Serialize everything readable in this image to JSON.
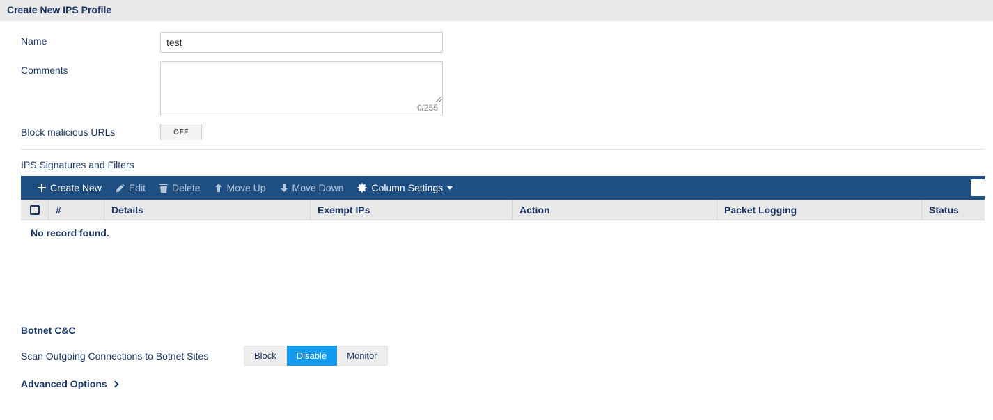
{
  "header": {
    "title": "Create New IPS Profile"
  },
  "form": {
    "name_label": "Name",
    "name_value": "test",
    "comments_label": "Comments",
    "comments_value": "",
    "comments_counter": "0/255",
    "block_urls_label": "Block malicious URLs",
    "block_urls_toggle": "OFF"
  },
  "signatures": {
    "section_label": "IPS Signatures and Filters",
    "toolbar": {
      "create_new": "Create New",
      "edit": "Edit",
      "delete": "Delete",
      "move_up": "Move Up",
      "move_down": "Move Down",
      "column_settings": "Column Settings"
    },
    "columns": {
      "num": "#",
      "details": "Details",
      "exempt": "Exempt IPs",
      "action": "Action",
      "packet": "Packet Logging",
      "status": "Status"
    },
    "empty": "No record found."
  },
  "botnet": {
    "title": "Botnet C&C",
    "row_label": "Scan Outgoing Connections to Botnet Sites",
    "options": {
      "block": "Block",
      "disable": "Disable",
      "monitor": "Monitor"
    },
    "selected": "disable"
  },
  "advanced": {
    "label": "Advanced Options"
  }
}
